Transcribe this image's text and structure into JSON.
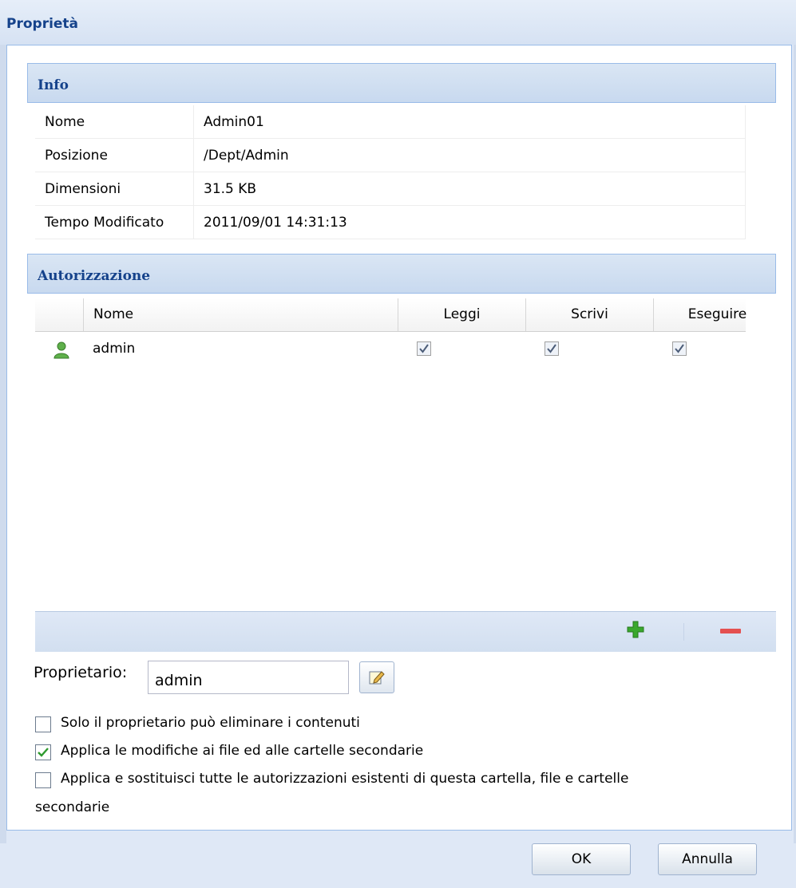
{
  "window": {
    "title": "Proprietà"
  },
  "info": {
    "header": "Info",
    "rows": [
      {
        "key": "Nome",
        "value": "Admin01"
      },
      {
        "key": "Posizione",
        "value": "/Dept/Admin"
      },
      {
        "key": "Dimensioni",
        "value": "31.5 KB"
      },
      {
        "key": "Tempo Modificato",
        "value": "2011/09/01 14:31:13"
      }
    ]
  },
  "permissions": {
    "header": "Autorizzazione",
    "columns": {
      "name": "Nome",
      "read": "Leggi",
      "write": "Scrivi",
      "execute": "Eseguire"
    },
    "rows": [
      {
        "icon": "user-icon",
        "name": "admin",
        "read": true,
        "write": true,
        "execute": true
      }
    ],
    "toolbar": {
      "add_icon": "plus-icon",
      "remove_icon": "minus-icon"
    }
  },
  "owner": {
    "label": "Proprietario:",
    "value": "admin",
    "edit_icon": "edit-icon"
  },
  "options": [
    {
      "label": "Solo il proprietario può eliminare i contenuti",
      "checked": false
    },
    {
      "label": "Applica le modifiche ai file ed alle cartelle secondarie",
      "checked": true
    },
    {
      "label": "Applica e sostituisci tutte le autorizzazioni esistenti di questa cartella, file e cartelle",
      "label_cont": "secondarie",
      "checked": false
    }
  ],
  "buttons": {
    "ok": "OK",
    "cancel": "Annulla"
  },
  "colors": {
    "header_text": "#15428b",
    "panel_border": "#99bbe8",
    "add": "#3aa82d",
    "remove": "#e45050"
  }
}
